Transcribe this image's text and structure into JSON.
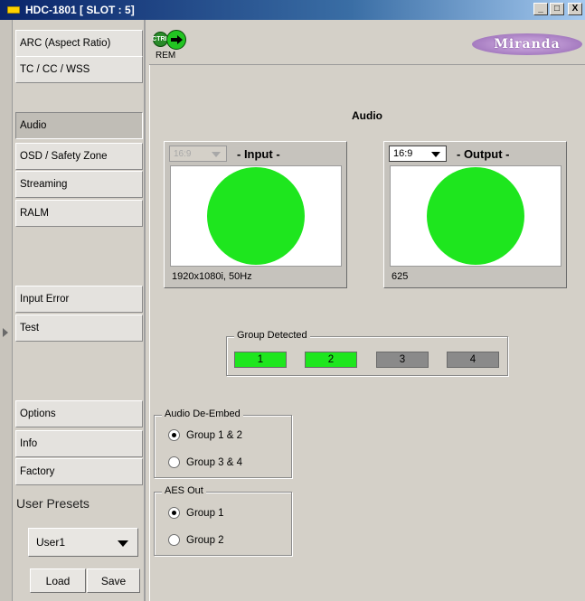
{
  "window": {
    "title": "HDC-1801 [ SLOT : 5]",
    "min_label": "_",
    "max_label": "□",
    "close_label": "X"
  },
  "sidebar": {
    "items": [
      {
        "label": "ARC (Aspect Ratio)"
      },
      {
        "label": "TC / CC / WSS"
      },
      {
        "label": "Audio",
        "active": true
      },
      {
        "label": "OSD / Safety Zone"
      },
      {
        "label": "Streaming"
      },
      {
        "label": "RALM"
      },
      {
        "label": "Input Error"
      },
      {
        "label": "Test"
      },
      {
        "label": "Options"
      },
      {
        "label": "Info"
      },
      {
        "label": "Factory"
      }
    ],
    "presets_label": "User Presets",
    "preset_value": "User1",
    "load_label": "Load",
    "save_label": "Save"
  },
  "toolbar": {
    "ctrl_label": "CTRL",
    "rem_label": "REM",
    "logo_text": "Miranda"
  },
  "main": {
    "title": "Audio",
    "input": {
      "aspect": "16:9",
      "title": "- Input -",
      "format": "1920x1080i, 50Hz",
      "signal_color": "#1ee61e"
    },
    "output": {
      "aspect": "16:9",
      "title": "- Output -",
      "format": "625",
      "signal_color": "#1ee61e"
    },
    "group_detected": {
      "legend": "Group Detected",
      "groups": [
        {
          "label": "1",
          "detected": true,
          "color": "#1ee61e"
        },
        {
          "label": "2",
          "detected": true,
          "color": "#1ee61e"
        },
        {
          "label": "3",
          "detected": false,
          "color": "#8a8a8a"
        },
        {
          "label": "4",
          "detected": false,
          "color": "#8a8a8a"
        }
      ]
    },
    "audio_deembed": {
      "legend": "Audio De-Embed",
      "options": [
        {
          "label": "Group 1 & 2",
          "selected": true
        },
        {
          "label": "Group 3 & 4",
          "selected": false
        }
      ]
    },
    "aes_out": {
      "legend": "AES Out",
      "options": [
        {
          "label": "Group 1",
          "selected": true
        },
        {
          "label": "Group 2",
          "selected": false
        }
      ]
    }
  },
  "colors": {
    "accent_green": "#1ee61e",
    "title_bar": "#0a246a",
    "logo": "#a57bc0"
  },
  "icons": [
    "app-icon",
    "ctrl-icon",
    "remote-arrow-icon",
    "miranda-logo",
    "chevron-down-icon"
  ]
}
